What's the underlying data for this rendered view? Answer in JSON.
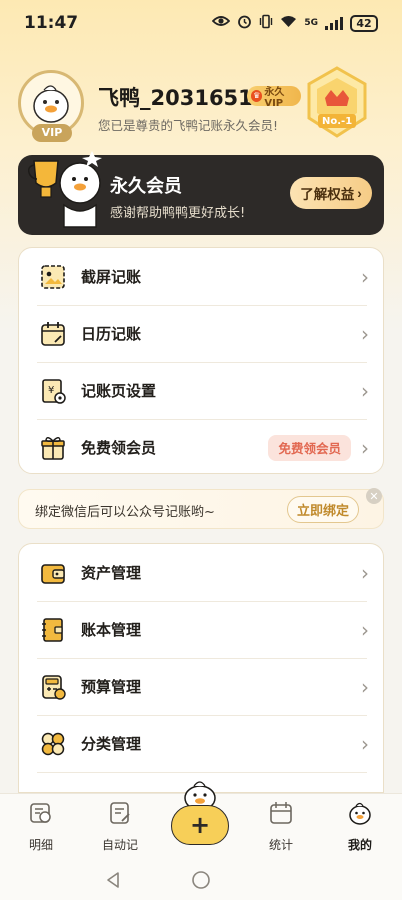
{
  "status_bar": {
    "time": "11:47",
    "network": "5G",
    "battery": "42"
  },
  "profile": {
    "username": "飞鸭_2031651",
    "vip_badge": "永久VIP",
    "subtitle": "您已是尊贵的飞鸭记账永久会员!",
    "avatar_tag": "VIP",
    "medal_text": "No.-1"
  },
  "membership": {
    "title": "永久会员",
    "description": "感谢帮助鸭鸭更好成长!",
    "button_label": "了解权益"
  },
  "menu1": [
    {
      "label": "截屏记账",
      "icon": "screenshot-icon"
    },
    {
      "label": "日历记账",
      "icon": "calendar-icon"
    },
    {
      "label": "记账页设置",
      "icon": "settings-page-icon"
    },
    {
      "label": "免费领会员",
      "icon": "gift-icon",
      "pill": "免费领会员"
    }
  ],
  "wechat": {
    "text": "绑定微信后可以公众号记账哟~",
    "button": "立即绑定"
  },
  "menu2": [
    {
      "label": "资产管理",
      "icon": "wallet-icon"
    },
    {
      "label": "账本管理",
      "icon": "ledger-icon"
    },
    {
      "label": "预算管理",
      "icon": "calculator-icon"
    },
    {
      "label": "分类管理",
      "icon": "category-icon"
    }
  ],
  "nav": {
    "items": [
      {
        "label": "明细"
      },
      {
        "label": "自动记"
      },
      {
        "label": "统计"
      },
      {
        "label": "我的"
      }
    ],
    "fab": "+"
  },
  "colors": {
    "accent": "#f7cf58",
    "dark_card": "#2d2a28",
    "pill_text": "#e26952"
  }
}
